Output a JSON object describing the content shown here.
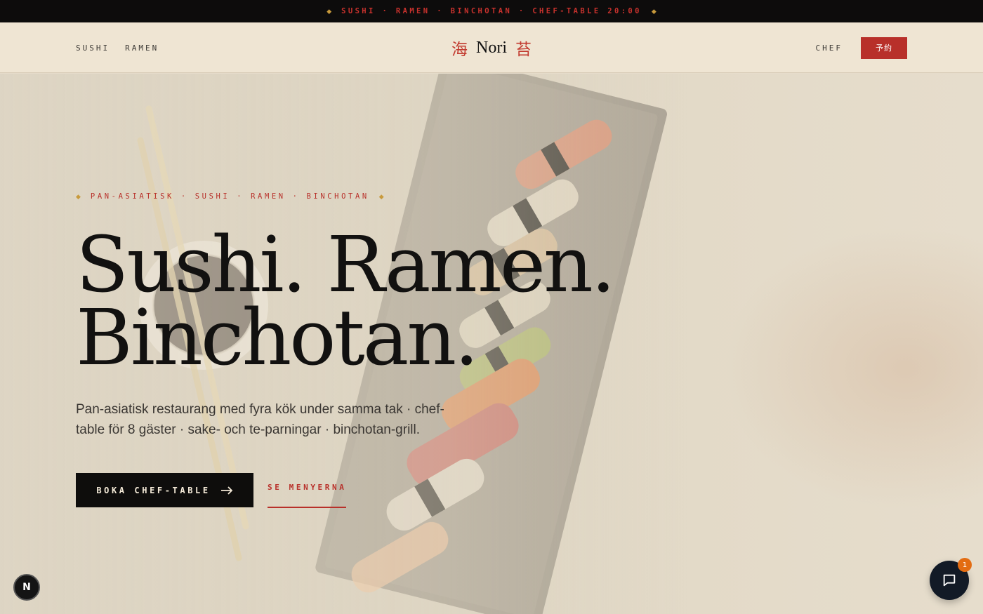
{
  "topbar": {
    "ticker": "SUSHI · RAMEN · BINCHOTAN · CHEF-TABLE 20:00",
    "diamond_icon": "◆"
  },
  "header": {
    "nav_left": [
      "SUSHI",
      "RAMEN"
    ],
    "logo": {
      "kanji_left": "海",
      "name": "Nori",
      "kanji_right": "苔"
    },
    "nav_right": [
      "CHEF"
    ],
    "reserve_label": "予約"
  },
  "hero": {
    "eyebrow": "PAN-ASIATISK · SUSHI · RAMEN · BINCHOTAN",
    "headline_line1": "Sushi. Ramen.",
    "headline_line2": "Binchotan.",
    "lead": "Pan-asiatisk restaurang med fyra kök under samma tak · chef-table för 8 gäster · sake- och te-parningar · binchotan-grill.",
    "cta_primary": "BOKA CHEF-TABLE",
    "cta_primary_icon": "arrow-right-icon",
    "cta_secondary": "SE MENYERNA"
  },
  "widgets": {
    "n_badge_label": "N",
    "chat_unread": "1",
    "chat_icon": "chat-bubble-icon"
  },
  "colors": {
    "accent_red": "#b8302a",
    "gold": "#c89a3c",
    "dark": "#0e0d0c",
    "cream": "#efe5d3",
    "chat_badge": "#e36c12"
  }
}
